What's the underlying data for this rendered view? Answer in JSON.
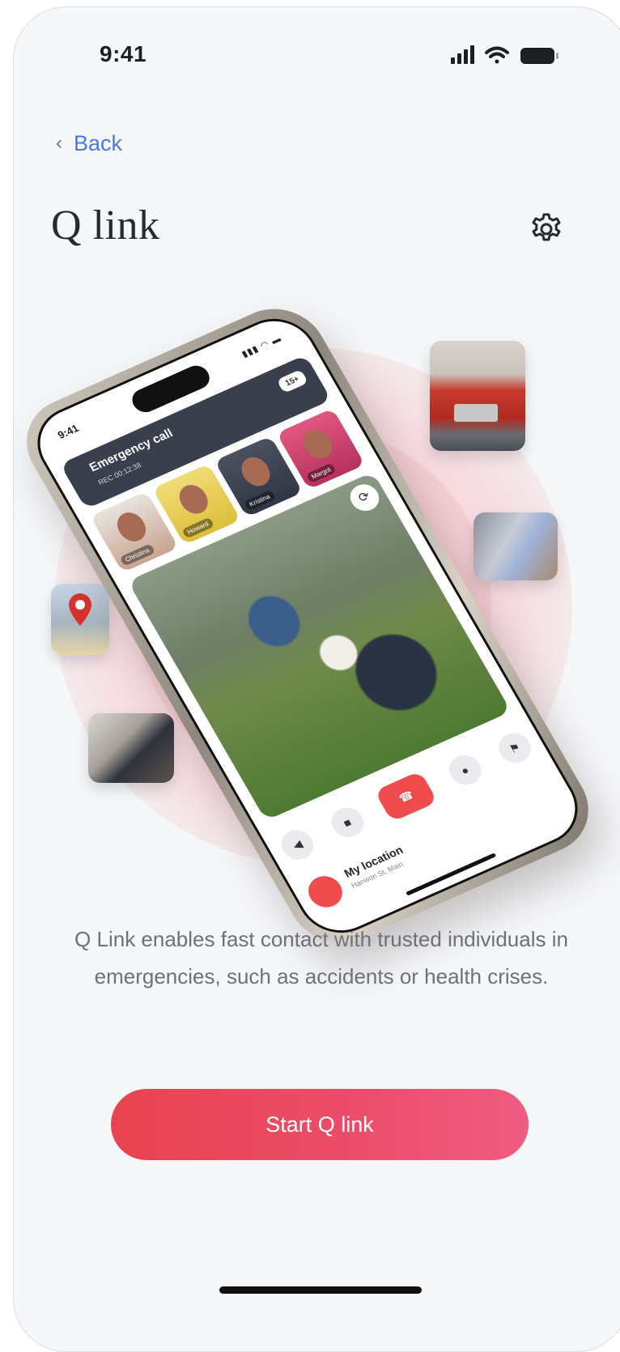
{
  "status_bar": {
    "time": "9:41",
    "icons": [
      "signal-icon",
      "wifi-icon",
      "battery-icon"
    ]
  },
  "nav": {
    "back_label": "Back"
  },
  "header": {
    "title": "Q link",
    "settings_icon": "gear-icon"
  },
  "hero": {
    "mock_phone": {
      "time": "9:41",
      "call_title": "Emergency call",
      "call_sub": "REC 00:12:38",
      "participants_badge": "15+",
      "participants": [
        "Christina",
        "Howard",
        "Kristina",
        "Margot"
      ],
      "my_location_title": "My location",
      "my_location_sub": "Hanwon St, Main"
    },
    "tiles": [
      "fire-truck-image",
      "hospital-image",
      "map-pin-image",
      "phone-in-hand-image"
    ]
  },
  "description": "Q Link enables fast contact with trusted individuals in emergencies, such as accidents or health crises.",
  "cta": {
    "label": "Start Q link"
  },
  "colors": {
    "accent": "#ec4d6b",
    "link": "#4a78e0",
    "title": "#262a33",
    "body": "#6e7178"
  }
}
